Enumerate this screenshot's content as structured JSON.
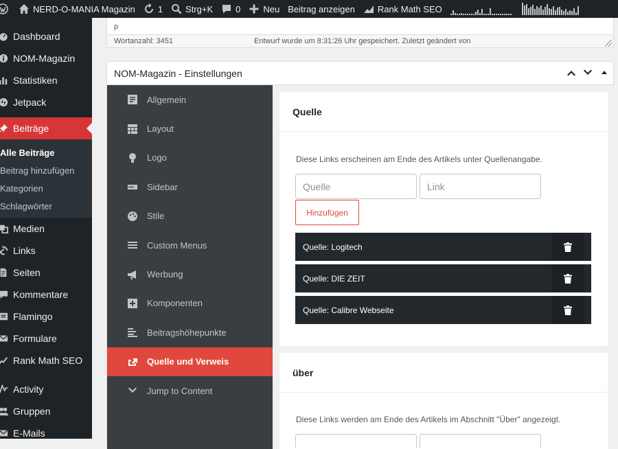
{
  "adminbar": {
    "site_name": "NERD-O-MANIA Magazin",
    "updates_count": "1",
    "shortcut_label": "Strg+K",
    "comments_count": "0",
    "new_label": "Neu",
    "view_post_label": "Beitrag anzeigen",
    "seo_label": "Rank Math SEO"
  },
  "sidebar": {
    "items": [
      {
        "label": "Dashboard",
        "icon": "dashboard-icon"
      },
      {
        "label": "NOM-Magazin",
        "icon": "info-icon"
      },
      {
        "label": "Statistiken",
        "icon": "stats-icon"
      },
      {
        "label": "Jetpack",
        "icon": "jetpack-icon"
      },
      {
        "label": "Beiträge",
        "icon": "pin-icon"
      },
      {
        "label": "Medien",
        "icon": "media-icon"
      },
      {
        "label": "Links",
        "icon": "link-icon"
      },
      {
        "label": "Seiten",
        "icon": "page-icon"
      },
      {
        "label": "Kommentare",
        "icon": "comment-icon"
      },
      {
        "label": "Flamingo",
        "icon": "flamingo-icon"
      },
      {
        "label": "Formulare",
        "icon": "mail-icon"
      },
      {
        "label": "Rank Math SEO",
        "icon": "chart-icon"
      },
      {
        "label": "Activity",
        "icon": "activity-icon"
      },
      {
        "label": "Gruppen",
        "icon": "groups-icon"
      },
      {
        "label": "E-Mails",
        "icon": "email-icon"
      }
    ],
    "submenu": [
      "Alle Beiträge",
      "Beitrag hinzufügen",
      "Kategorien",
      "Schlagwörter"
    ]
  },
  "editor": {
    "path": "p",
    "word_count": "Wortanzahl: 3451",
    "draft_status": "Entwurf wurde um 8:31:26 Uhr gespeichert. Zuletzt geändert von"
  },
  "metabox": {
    "title": "NOM-Magazin - Einstellungen",
    "nav": [
      {
        "label": "Allgemein",
        "icon": "settings-icon"
      },
      {
        "label": "Layout",
        "icon": "layout-icon"
      },
      {
        "label": "Logo",
        "icon": "bulb-icon"
      },
      {
        "label": "Sidebar",
        "icon": "sidebar-icon"
      },
      {
        "label": "Stile",
        "icon": "palette-icon"
      },
      {
        "label": "Custom Menus",
        "icon": "menu-icon"
      },
      {
        "label": "Werbung",
        "icon": "megaphone-icon"
      },
      {
        "label": "Komponenten",
        "icon": "components-icon"
      },
      {
        "label": "Beitragshöhepunkte",
        "icon": "highlights-icon"
      },
      {
        "label": "Quelle und Verweis",
        "icon": "share-icon"
      },
      {
        "label": "Jump to Content",
        "icon": "chevron-down-icon"
      }
    ],
    "quelle": {
      "title": "Quelle",
      "description": "Diese Links erscheinen am Ende des Artikels unter Quellenangabe.",
      "source_placeholder": "Quelle",
      "link_placeholder": "Link",
      "add_label": "Hinzufügen",
      "entries": [
        "Quelle: Logitech",
        "Quelle: DIE ZEIT",
        "Quelle: Calibre Webseite"
      ]
    },
    "ueber": {
      "title": "über",
      "description": "Diese Links werden am Ende des Artikels im Abschnitt \"Über\" angezeigt."
    }
  }
}
